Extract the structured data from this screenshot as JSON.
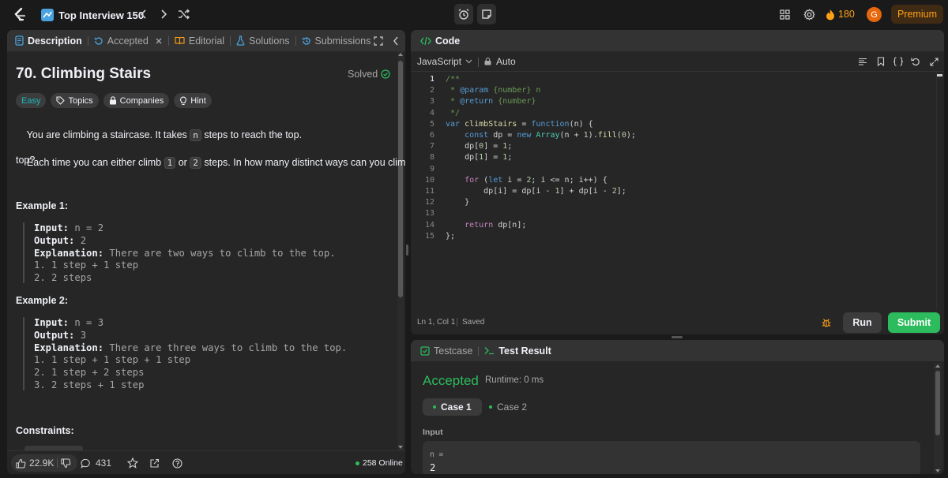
{
  "topbar": {
    "title": "Top Interview 150",
    "streak": "180",
    "avatar_letter": "G",
    "premium_label": "Premium",
    "colors": {
      "streak": "#ffa116",
      "premium_bg": "#3f2a14",
      "premium_text": "#ffa116"
    }
  },
  "left": {
    "tabs": {
      "description": "Description",
      "accepted": "Accepted",
      "editorial": "Editorial",
      "solutions": "Solutions",
      "submissions": "Submissions"
    },
    "problem": {
      "title": "70. Climbing Stairs",
      "status": "Solved",
      "tags": {
        "difficulty": "Easy",
        "topics": "Topics",
        "companies": "Companies",
        "hint": "Hint"
      },
      "p1_pre": "You are climbing a staircase. It takes ",
      "p1_code": "n",
      "p1_post": " steps to reach the top.",
      "p2_pre": "Each time you can either climb ",
      "p2_code1": "1",
      "p2_mid": " or ",
      "p2_code2": "2",
      "p2_post": " steps. In how many distinct ways can you climb to the",
      "p2_line2": "top?",
      "example1_heading": "Example 1:",
      "example1": {
        "input_label": "Input:",
        "input_value": " n = 2",
        "output_label": "Output:",
        "output_value": " 2",
        "explanation_label": "Explanation:",
        "explanation_value": " There are two ways to climb to the top.",
        "lines": [
          "1. 1 step + 1 step",
          "2. 2 steps"
        ]
      },
      "example2_heading": "Example 2:",
      "example2": {
        "input_label": "Input:",
        "input_value": " n = 3",
        "output_label": "Output:",
        "output_value": " 3",
        "explanation_label": "Explanation:",
        "explanation_value": " There are three ways to climb to the top.",
        "lines": [
          "1. 1 step + 1 step + 1 step",
          "2. 1 step + 2 steps",
          "3. 2 steps + 1 step"
        ]
      },
      "constraints_heading": "Constraints:"
    },
    "footer": {
      "likes": "22.9K",
      "comments": "431",
      "online": "258 Online"
    }
  },
  "code": {
    "header": "Code",
    "language": "JavaScript",
    "auto": "Auto",
    "status_position": "Ln 1, Col 1",
    "status_saved": "Saved",
    "run_label": "Run",
    "submit_label": "Submit",
    "lines": [
      "/**",
      " * @param {number} n",
      " * @return {number}",
      " */",
      "var climbStairs = function(n) {",
      "    const dp = new Array(n + 1).fill(0);",
      "    dp[0] = 1;",
      "    dp[1] = 1;",
      "",
      "    for (let i = 2; i <= n; i++) {",
      "        dp[i] = dp[i - 1] + dp[i - 2];",
      "    }",
      "",
      "    return dp[n];",
      "};"
    ]
  },
  "result": {
    "tab_testcase": "Testcase",
    "tab_result": "Test Result",
    "verdict": "Accepted",
    "runtime": "Runtime: 0 ms",
    "case1": "Case 1",
    "case2": "Case 2",
    "input_label": "Input",
    "var_label": "n =",
    "var_value": "2",
    "colors": {
      "accepted": "#2cbb5d"
    }
  }
}
